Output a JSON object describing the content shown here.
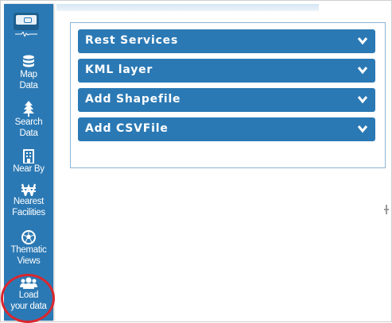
{
  "sidebar": {
    "logo_icon": "monitor-logo-icon",
    "items": [
      {
        "icon": "database-icon",
        "lines": [
          "Map",
          "Data"
        ]
      },
      {
        "icon": "tree-icon",
        "lines": [
          "Search",
          "Data"
        ]
      },
      {
        "icon": "building-icon",
        "lines": [
          "Near By"
        ]
      },
      {
        "icon": "won-currency-icon",
        "lines": [
          "Nearest",
          "Facilities"
        ]
      },
      {
        "icon": "football-icon",
        "lines": [
          "Thematic",
          "Views"
        ]
      },
      {
        "icon": "users-icon",
        "lines": [
          "Load",
          "your data"
        ]
      }
    ],
    "highlight_color": "#d9272e"
  },
  "panel": {
    "accordion": [
      {
        "title": "Rest Services",
        "icon": "chevron-down-icon"
      },
      {
        "title": "KML layer",
        "icon": "chevron-down-icon"
      },
      {
        "title": "Add Shapefile",
        "icon": "chevron-down-icon"
      },
      {
        "title": "Add CSVFile",
        "icon": "chevron-down-icon"
      }
    ]
  },
  "colors": {
    "accent": "#2b79b4",
    "panel_border": "#8bb5d6"
  }
}
